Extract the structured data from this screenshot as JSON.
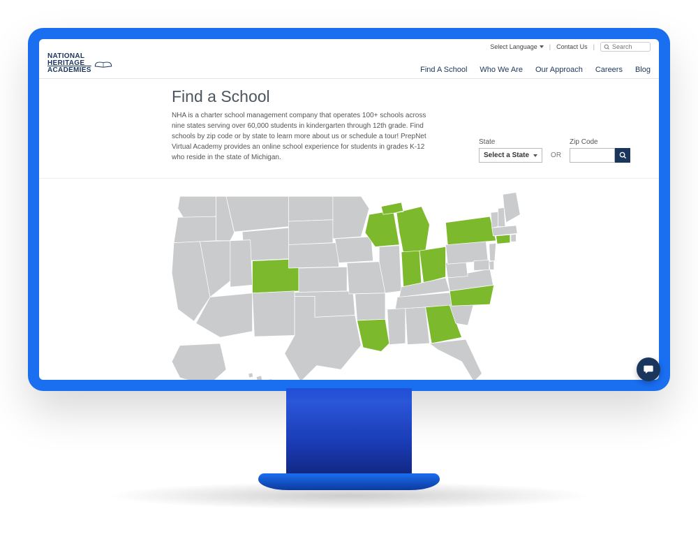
{
  "logo": {
    "line1": "NATIONAL",
    "line2": "HERITAGE",
    "line3": "ACADEMIES"
  },
  "topbar": {
    "language": "Select Language",
    "contact": "Contact Us",
    "search_placeholder": "Search"
  },
  "nav": {
    "find": "Find A School",
    "who": "Who We Are",
    "approach": "Our Approach",
    "careers": "Careers",
    "blog": "Blog"
  },
  "hero": {
    "title": "Find a School",
    "body": "NHA is a charter school management company that operates 100+ schools across nine states serving over 60,000 students in kindergarten through 12th grade. Find schools by zip code or by state to learn more about us or schedule a tour! PrepNet Virtual Academy provides an online school experience for students in grades K-12 who reside in the state of Michigan."
  },
  "filters": {
    "state_label": "State",
    "state_selected": "Select a State",
    "or": "OR",
    "zip_label": "Zip Code",
    "zip_value": ""
  },
  "map": {
    "active_states": [
      "Michigan",
      "Wisconsin",
      "Indiana",
      "Ohio",
      "New York",
      "Colorado",
      "Louisiana",
      "Georgia",
      "North Carolina"
    ]
  }
}
